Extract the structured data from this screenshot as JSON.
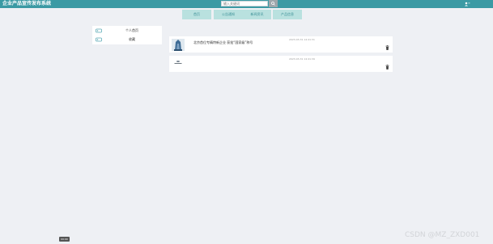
{
  "app": {
    "title": "企业产品宣传发布系统"
  },
  "search": {
    "placeholder": "输入关键词"
  },
  "nav": {
    "tabs": [
      {
        "label": "首页"
      },
      {
        "label": "公告通知"
      },
      {
        "label": "新闻资讯"
      },
      {
        "label": "产品信息"
      }
    ]
  },
  "sidebar": {
    "items": [
      {
        "label": "个人首页"
      },
      {
        "label": "收藏"
      }
    ]
  },
  "favorites": [
    {
      "title": "北京首位专精特新企业 获批“国家级”称号",
      "time": "2023-03-31 14:41:31"
    },
    {
      "title": "",
      "time": "2023-03-31 14:41:39"
    }
  ],
  "overlay": {
    "watermark": "CSDN @MZ_ZXD001",
    "time_badge": "00:00"
  },
  "colors": {
    "topbar": "#3b9aa4",
    "tab_bg": "#b9e1df",
    "tab_text": "#3b8f96",
    "page_bg": "#eef0f4"
  }
}
